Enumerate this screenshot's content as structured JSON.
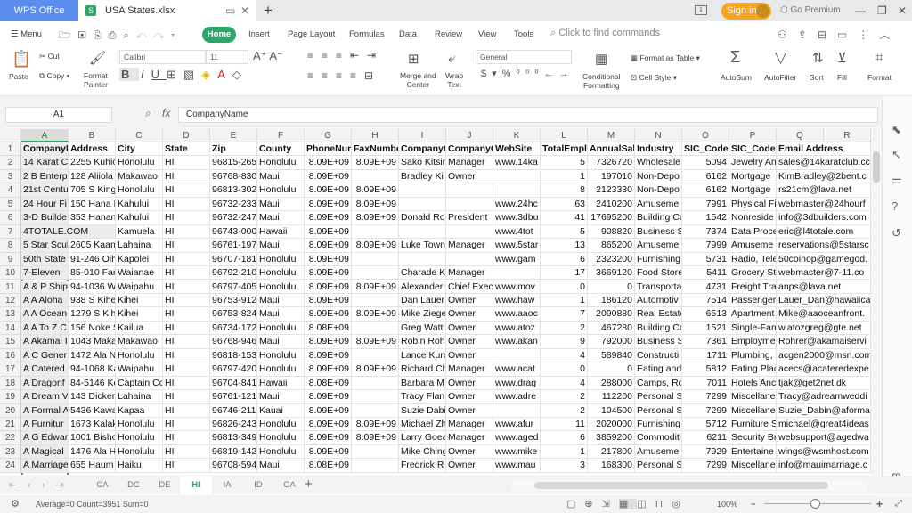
{
  "titlebar": {
    "app": "WPS Office",
    "file": "USA States.xlsx",
    "badge": "1",
    "signin": "Sign in",
    "premium": "Go Premium"
  },
  "menubar": {
    "menu": "Menu",
    "tabs": [
      "Home",
      "Insert",
      "Page Layout",
      "Formulas",
      "Data",
      "Review",
      "View",
      "Tools"
    ],
    "search_placeholder": "Click to find commands"
  },
  "ribbon": {
    "paste": "Paste",
    "cut": "Cut",
    "copy": "Copy",
    "format_painter": [
      "Format",
      "Painter"
    ],
    "font": "Calibri",
    "size": "11",
    "merge": [
      "Merge and",
      "Center"
    ],
    "wrap": [
      "Wrap",
      "Text"
    ],
    "number_format": "General",
    "conditional": [
      "Conditional",
      "Formatting"
    ],
    "format_table": "Format as Table",
    "cell_style": "Cell Style",
    "autosum": "AutoSum",
    "autofilter": "AutoFilter",
    "sort": "Sort",
    "fill": "Fill",
    "format": "Format"
  },
  "formula": {
    "cell": "A1",
    "value": "CompanyName",
    "fx": "fx"
  },
  "columns": [
    "A",
    "B",
    "C",
    "D",
    "E",
    "F",
    "G",
    "H",
    "I",
    "J",
    "K",
    "L",
    "M",
    "N",
    "O",
    "P",
    "Q",
    "R"
  ],
  "numeric_columns": [
    6,
    7,
    11,
    12,
    14
  ],
  "rows": [
    [
      "CompanyName",
      "Address",
      "City",
      "State",
      "Zip",
      "County",
      "PhoneNum",
      "FaxNumbe",
      "CompanyC",
      "CompanyC",
      "WebSite",
      "TotalEmpl",
      "AnnualSal",
      "Industry",
      "SIC_Code",
      "SIC_Code_",
      "Email Address"
    ],
    [
      "14 Karat C",
      "2255 Kuhio",
      "Honolulu",
      "HI",
      "96815-265",
      "Honolulu",
      "8.09E+09",
      "8.09E+09",
      "Sako Kitsin",
      "Manager",
      "www.14ka",
      "5",
      "7326720",
      "Wholesale",
      "5094",
      "Jewelry An",
      "sales@14karatclub.cc"
    ],
    [
      "2 B Enterp",
      "128 Aliiola",
      "Makawao",
      "HI",
      "96768-830",
      "Maui",
      "8.09E+09",
      "",
      "Bradley Ki",
      "Owner",
      "",
      "1",
      "197010",
      "Non-Depo",
      "6162",
      "Mortgage",
      "KimBradley@2bent.c"
    ],
    [
      "21st Centu",
      "705 S King",
      "Honolulu",
      "HI",
      "96813-302",
      "Honolulu",
      "8.09E+09",
      "8.09E+09",
      "",
      "",
      "",
      "8",
      "2123330",
      "Non-Depo",
      "6162",
      "Mortgage",
      "rs21cm@lava.net"
    ],
    [
      "24 Hour Fi",
      "150 Hana I",
      "Kahului",
      "HI",
      "96732-233",
      "Maui",
      "8.09E+09",
      "8.09E+09",
      "",
      "",
      "www.24hc",
      "63",
      "2410200",
      "Amuseme",
      "7991",
      "Physical Fi",
      "webmaster@24hourf"
    ],
    [
      "3-D Builde",
      "353 Hanan",
      "Kahului",
      "HI",
      "96732-247",
      "Maui",
      "8.09E+09",
      "8.09E+09",
      "Donald Ro",
      "President",
      "www.3dbu",
      "41",
      "17695200",
      "Building Cc",
      "1542",
      "Nonreside",
      "info@3dbuilders.com"
    ],
    [
      "4TOTALE.COM",
      "",
      "Kamuela",
      "HI",
      "96743-000",
      "Hawaii",
      "8.09E+09",
      "",
      "",
      "",
      "www.4tot",
      "5",
      "908820",
      "Business S",
      "7374",
      "Data Proce",
      "eric@l4totale.com"
    ],
    [
      "5 Star Scub",
      "2605 Kaan",
      "Lahaina",
      "HI",
      "96761-197",
      "Maui",
      "8.09E+09",
      "8.09E+09",
      "Luke Town",
      "Manager",
      "www.5star",
      "13",
      "865200",
      "Amuseme",
      "7999",
      "Amuseme",
      "reservations@5starsc"
    ],
    [
      "50th State",
      "91-246 Oih",
      "Kapolei",
      "HI",
      "96707-181",
      "Honolulu",
      "8.09E+09",
      "",
      "",
      "",
      "www.gam",
      "6",
      "2323200",
      "Furnishing",
      "5731",
      "Radio, Tele",
      "50coinop@gamegod."
    ],
    [
      "7-Eleven",
      "85-010 Far",
      "Waianae",
      "HI",
      "96792-210",
      "Honolulu",
      "8.09E+09",
      "",
      "Charade K",
      "Manager",
      "",
      "17",
      "3669120",
      "Food Store",
      "5411",
      "Grocery St",
      "webmaster@7-11.co"
    ],
    [
      "A & P Ship",
      "94-1036 W",
      "Waipahu",
      "HI",
      "96797-405",
      "Honolulu",
      "8.09E+09",
      "8.09E+09",
      "Alexander",
      "Chief Exec",
      "www.mov",
      "0",
      "0",
      "Transporta",
      "4731",
      "Freight Tra",
      "anps@lava.net"
    ],
    [
      "A A Aloha",
      "938 S Kihei",
      "Kihei",
      "HI",
      "96753-912",
      "Maui",
      "8.09E+09",
      "",
      "Dan Lauer",
      "Owner",
      "www.haw",
      "1",
      "186120",
      "Automotiv",
      "7514",
      "Passenger",
      "Lauer_Dan@hawaiica"
    ],
    [
      "A A Ocean",
      "1279 S Kih",
      "Kihei",
      "HI",
      "96753-824",
      "Maui",
      "8.09E+09",
      "8.09E+09",
      "Mike Ziege",
      "Owner",
      "www.aaoc",
      "7",
      "2090880",
      "Real Estate",
      "6513",
      "Apartment",
      "Mike@aaoceanfront."
    ],
    [
      "A A To Z C",
      "156 Noke S",
      "Kailua",
      "HI",
      "96734-172",
      "Honolulu",
      "8.08E+09",
      "",
      "Greg Watt",
      "Owner",
      "www.atoz",
      "2",
      "467280",
      "Building Cc",
      "1521",
      "Single-Fam",
      "w.atozgreg@gte.net"
    ],
    [
      "A Akamai I",
      "1043 Maka",
      "Makawao",
      "HI",
      "96768-946",
      "Maui",
      "8.09E+09",
      "8.09E+09",
      "Robin Roh",
      "Owner",
      "www.akan",
      "9",
      "792000",
      "Business S",
      "7361",
      "Employme",
      "Rohrer@akamaiservi"
    ],
    [
      "A C Gener",
      "1472 Ala N",
      "Honolulu",
      "HI",
      "96818-153",
      "Honolulu",
      "8.09E+09",
      "",
      "Lance Kurc",
      "Owner",
      "",
      "4",
      "589840",
      "Constructi",
      "1711",
      "Plumbing,",
      "acgen2000@msn.com"
    ],
    [
      "A Catered",
      "94-1068 Ka",
      "Waipahu",
      "HI",
      "96797-420",
      "Honolulu",
      "8.09E+09",
      "8.09E+09",
      "Richard Ch",
      "Manager",
      "www.acat",
      "0",
      "0",
      "Eating and",
      "5812",
      "Eating Plac",
      "acecs@acateredexpe"
    ],
    [
      "A Dragonf",
      "84-5146 Ke",
      "Captain Cc",
      "HI",
      "96704-841",
      "Hawaii",
      "8.08E+09",
      "",
      "Barbara M",
      "Owner",
      "www.drag",
      "4",
      "288000",
      "Camps, Ro",
      "7011",
      "Hotels Anc",
      "tjak@get2net.dk"
    ],
    [
      "A Dream V",
      "143 Dicker",
      "Lahaina",
      "HI",
      "96761-121",
      "Maui",
      "8.09E+09",
      "",
      "Tracy Flan",
      "Owner",
      "www.adre",
      "2",
      "112200",
      "Personal S",
      "7299",
      "Miscellane",
      "Tracy@adreamweddi"
    ],
    [
      "A Formal A",
      "5436 Kawa",
      "Kapaa",
      "HI",
      "96746-211",
      "Kauai",
      "8.09E+09",
      "",
      "Suzie Dabi",
      "Owner",
      "",
      "2",
      "104500",
      "Personal S",
      "7299",
      "Miscellane",
      "Suzie_Dabin@aforma"
    ],
    [
      "A Furnitur",
      "1673 Kalak",
      "Honolulu",
      "HI",
      "96826-243",
      "Honolulu",
      "8.09E+09",
      "8.09E+09",
      "Michael Zh",
      "Manager",
      "www.afur",
      "11",
      "2020000",
      "Furnishing",
      "5712",
      "Furniture S",
      "michael@great4ideas"
    ],
    [
      "A G Edwar",
      "1001 Bisho",
      "Honolulu",
      "HI",
      "96813-349",
      "Honolulu",
      "8.09E+09",
      "8.09E+09",
      "Larry Goea",
      "Manager",
      "www.aged",
      "6",
      "3859200",
      "Commodit",
      "6211",
      "Security Br",
      "websupport@agedwa"
    ],
    [
      "A Magical",
      "1476 Ala H",
      "Honolulu",
      "HI",
      "96819-142",
      "Honolulu",
      "8.09E+09",
      "",
      "Mike Ching",
      "Owner",
      "www.mike",
      "1",
      "217800",
      "Amuseme",
      "7929",
      "Entertaine",
      "wings@wsmhost.com"
    ],
    [
      "A Marriage",
      "655 Haum",
      "Haiku",
      "HI",
      "96708-594",
      "Maui",
      "8.08E+09",
      "",
      "Fredrick R",
      "Owner",
      "www.mau",
      "3",
      "168300",
      "Personal S",
      "7299",
      "Miscellane",
      "info@mauimarriage.c"
    ]
  ],
  "sheets": [
    "CA",
    "DC",
    "DE",
    "HI",
    "IA",
    "ID",
    "GA"
  ],
  "active_sheet": "HI",
  "status": {
    "summary": "Average=0 Count=3951 Sum=0",
    "zoom": "100%",
    "zoom_level": 100
  },
  "colors": {
    "accent": "#2ea66a",
    "wps_blue": "#5b8def",
    "signin": "#f4a524"
  }
}
